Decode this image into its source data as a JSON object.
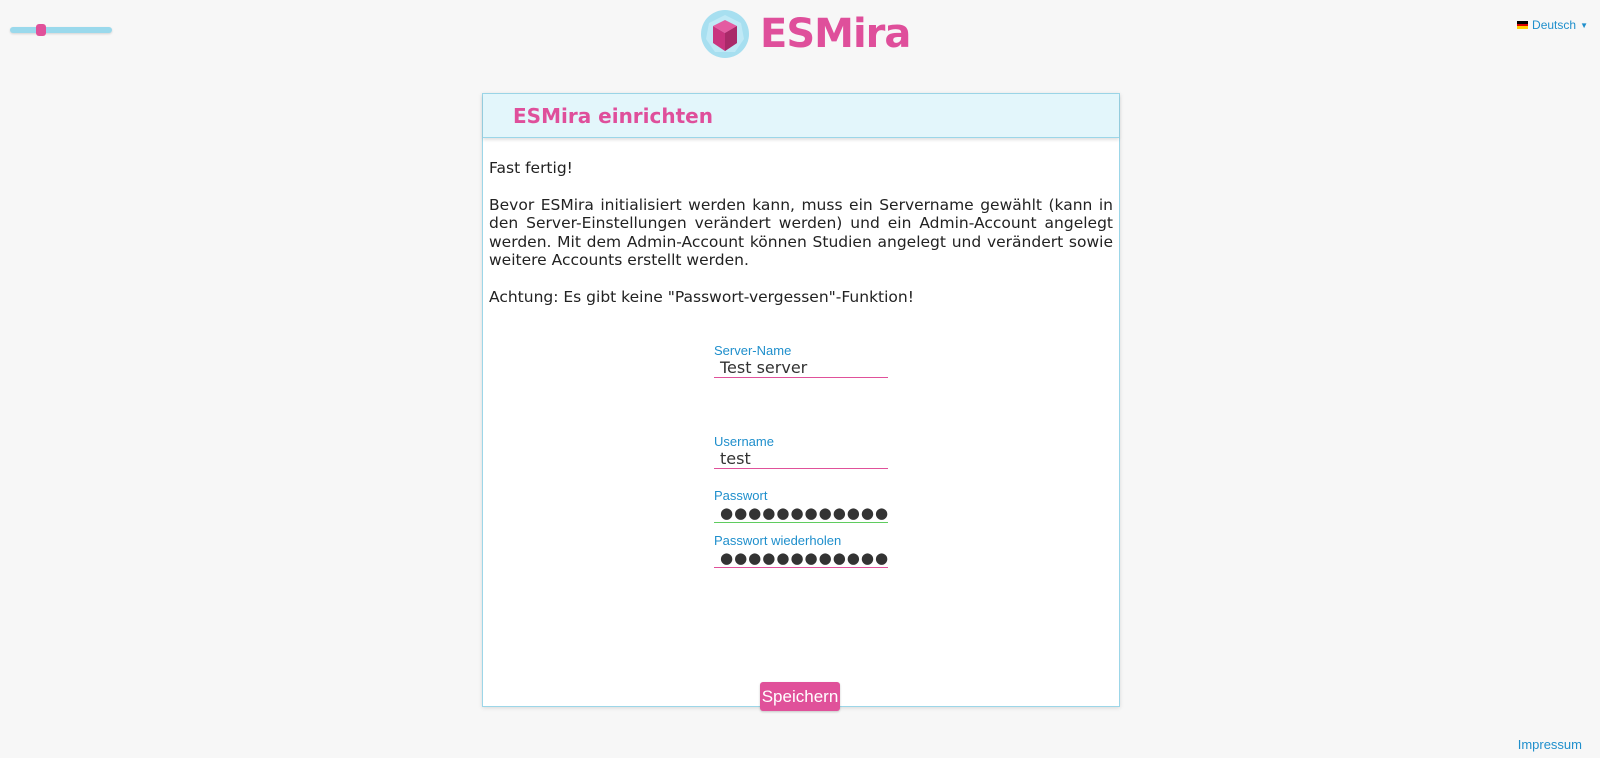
{
  "app": {
    "logo_text": "ESMira",
    "brand_color": "#df4f9b",
    "accent_color": "#1f8fcc"
  },
  "zoom": {
    "icon": "zoom-slider",
    "level": 0.28
  },
  "language": {
    "flag": "de-flag-icon",
    "label": "Deutsch"
  },
  "panel": {
    "title": "ESMira einrichten",
    "paragraphs": [
      "Fast fertig!",
      "Bevor ESMira initialisiert werden kann, muss ein Servername gewählt (kann in den Server-Einstellungen verändert werden) und ein Admin-Account angelegt werden. Mit dem Admin-Account können Studien angelegt und verändert sowie weitere Accounts erstellt werden.",
      "Achtung: Es gibt keine \"Passwort-vergessen\"-Funktion!"
    ]
  },
  "form": {
    "server_name": {
      "label": "Server-Name",
      "value": "Test server"
    },
    "username": {
      "label": "Username",
      "value": "test"
    },
    "password": {
      "label": "Passwort",
      "value": "●●●●●●●●●●●●"
    },
    "password_repeat": {
      "label": "Passwort wiederholen",
      "value": "●●●●●●●●●●●●"
    },
    "save_label": "Speichern"
  },
  "footer": {
    "impressum": "Impressum"
  }
}
